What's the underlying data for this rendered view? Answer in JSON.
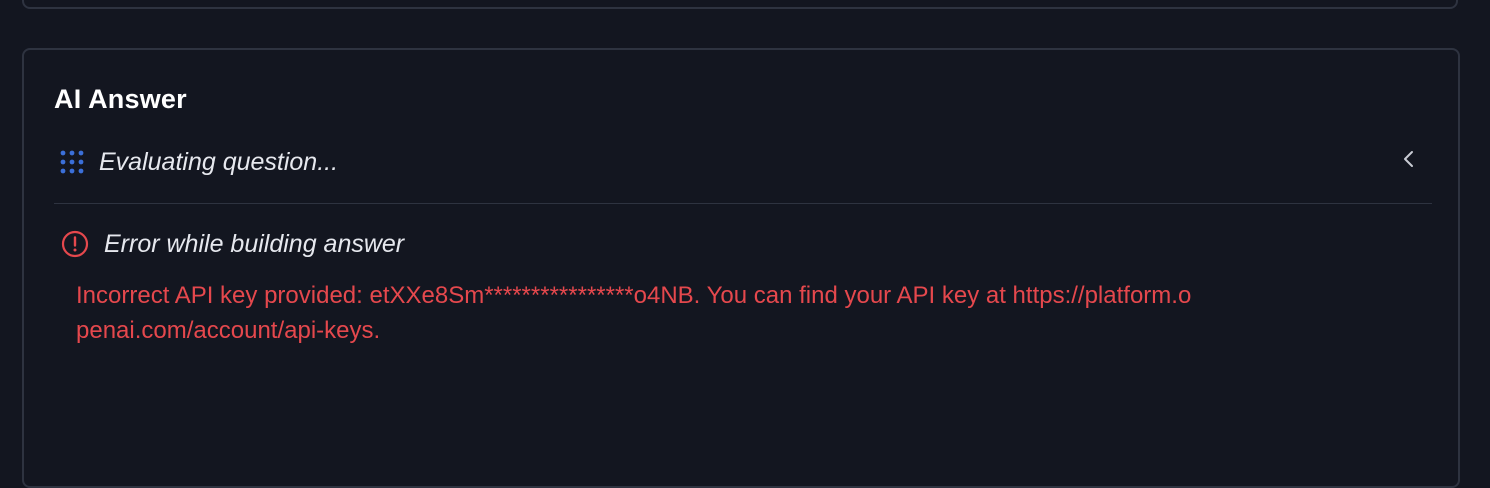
{
  "answer_card": {
    "title": "AI Answer",
    "status": {
      "icon": "loading-dots-icon",
      "text": "Evaluating question...",
      "collapse_icon": "chevron-left-icon"
    },
    "error": {
      "icon": "alert-circle-icon",
      "title": "Error while building answer",
      "message": "Incorrect API key provided: etXXe8Sm****************o4NB. You can find your API key at https://platform.openai.com/account/api-keys."
    }
  },
  "colors": {
    "background": "#131620",
    "border": "#2e3340",
    "error": "#e5484d",
    "spinner": "#3b6fd8",
    "text": "#e6e8ee"
  }
}
